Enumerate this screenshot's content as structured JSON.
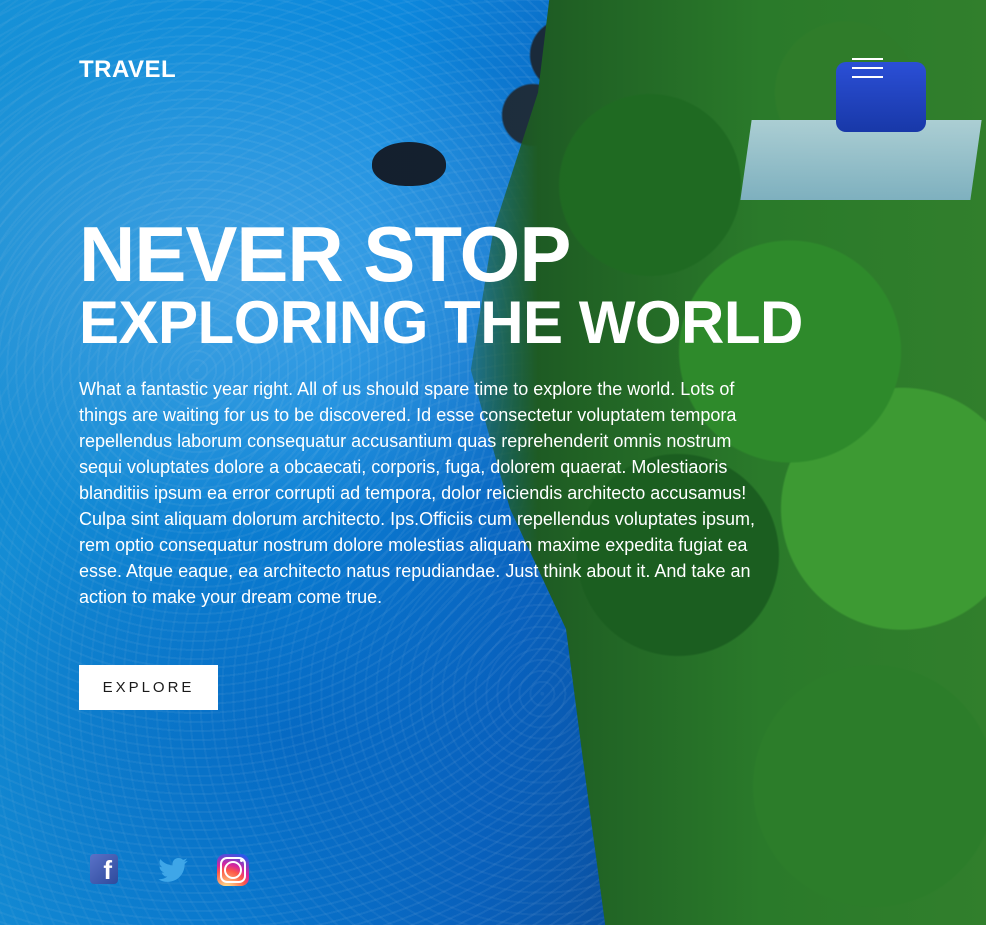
{
  "header": {
    "logo": "TRAVEL",
    "menu_icon": "hamburger-menu-icon"
  },
  "hero": {
    "title": "NEVER STOP",
    "subtitle": "EXPLORING THE WORLD",
    "text": "What a fantastic year right. All of us should spare time to explore the world. Lots of things are waiting for us to be discovered. Id esse consectetur voluptatem tempora repellendus laborum consequatur accusantium quas reprehenderit omnis nostrum sequi voluptates dolore a obcaecati, corporis, fuga, dolorem quaerat. Molestiaoris blanditiis ipsum ea error corrupti ad tempora, dolor reiciendis architecto accusamus! Culpa sint aliquam dolorum architecto. Ips.Officiis cum repellendus voluptates ipsum, rem optio consequatur nostrum dolore molestias aliquam maxime expedita fugiat ea esse. Atque eaque, ea architecto natus repudiandae. Just think about it. And take an action to make your dream come true.",
    "cta": "EXPLORE"
  },
  "social": [
    {
      "name": "facebook",
      "icon": "facebook-icon"
    },
    {
      "name": "twitter",
      "icon": "twitter-icon"
    },
    {
      "name": "instagram",
      "icon": "instagram-icon"
    }
  ],
  "colors": {
    "water": "#0d8ee5",
    "forest": "#2a7a2a",
    "text": "#ffffff",
    "button_bg": "#ffffff",
    "button_text": "#1a1a1a"
  }
}
